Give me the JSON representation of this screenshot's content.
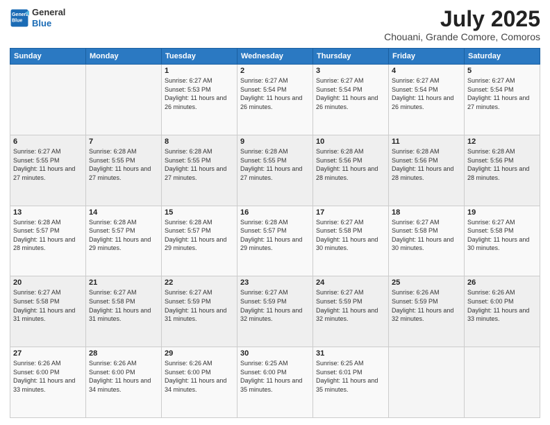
{
  "header": {
    "logo_line1": "General",
    "logo_line2": "Blue",
    "title": "July 2025",
    "subtitle": "Chouani, Grande Comore, Comoros"
  },
  "weekdays": [
    "Sunday",
    "Monday",
    "Tuesday",
    "Wednesday",
    "Thursday",
    "Friday",
    "Saturday"
  ],
  "weeks": [
    [
      {
        "day": "",
        "info": ""
      },
      {
        "day": "",
        "info": ""
      },
      {
        "day": "1",
        "info": "Sunrise: 6:27 AM\nSunset: 5:53 PM\nDaylight: 11 hours and 26 minutes."
      },
      {
        "day": "2",
        "info": "Sunrise: 6:27 AM\nSunset: 5:54 PM\nDaylight: 11 hours and 26 minutes."
      },
      {
        "day": "3",
        "info": "Sunrise: 6:27 AM\nSunset: 5:54 PM\nDaylight: 11 hours and 26 minutes."
      },
      {
        "day": "4",
        "info": "Sunrise: 6:27 AM\nSunset: 5:54 PM\nDaylight: 11 hours and 26 minutes."
      },
      {
        "day": "5",
        "info": "Sunrise: 6:27 AM\nSunset: 5:54 PM\nDaylight: 11 hours and 27 minutes."
      }
    ],
    [
      {
        "day": "6",
        "info": "Sunrise: 6:27 AM\nSunset: 5:55 PM\nDaylight: 11 hours and 27 minutes."
      },
      {
        "day": "7",
        "info": "Sunrise: 6:28 AM\nSunset: 5:55 PM\nDaylight: 11 hours and 27 minutes."
      },
      {
        "day": "8",
        "info": "Sunrise: 6:28 AM\nSunset: 5:55 PM\nDaylight: 11 hours and 27 minutes."
      },
      {
        "day": "9",
        "info": "Sunrise: 6:28 AM\nSunset: 5:55 PM\nDaylight: 11 hours and 27 minutes."
      },
      {
        "day": "10",
        "info": "Sunrise: 6:28 AM\nSunset: 5:56 PM\nDaylight: 11 hours and 28 minutes."
      },
      {
        "day": "11",
        "info": "Sunrise: 6:28 AM\nSunset: 5:56 PM\nDaylight: 11 hours and 28 minutes."
      },
      {
        "day": "12",
        "info": "Sunrise: 6:28 AM\nSunset: 5:56 PM\nDaylight: 11 hours and 28 minutes."
      }
    ],
    [
      {
        "day": "13",
        "info": "Sunrise: 6:28 AM\nSunset: 5:57 PM\nDaylight: 11 hours and 28 minutes."
      },
      {
        "day": "14",
        "info": "Sunrise: 6:28 AM\nSunset: 5:57 PM\nDaylight: 11 hours and 29 minutes."
      },
      {
        "day": "15",
        "info": "Sunrise: 6:28 AM\nSunset: 5:57 PM\nDaylight: 11 hours and 29 minutes."
      },
      {
        "day": "16",
        "info": "Sunrise: 6:28 AM\nSunset: 5:57 PM\nDaylight: 11 hours and 29 minutes."
      },
      {
        "day": "17",
        "info": "Sunrise: 6:27 AM\nSunset: 5:58 PM\nDaylight: 11 hours and 30 minutes."
      },
      {
        "day": "18",
        "info": "Sunrise: 6:27 AM\nSunset: 5:58 PM\nDaylight: 11 hours and 30 minutes."
      },
      {
        "day": "19",
        "info": "Sunrise: 6:27 AM\nSunset: 5:58 PM\nDaylight: 11 hours and 30 minutes."
      }
    ],
    [
      {
        "day": "20",
        "info": "Sunrise: 6:27 AM\nSunset: 5:58 PM\nDaylight: 11 hours and 31 minutes."
      },
      {
        "day": "21",
        "info": "Sunrise: 6:27 AM\nSunset: 5:58 PM\nDaylight: 11 hours and 31 minutes."
      },
      {
        "day": "22",
        "info": "Sunrise: 6:27 AM\nSunset: 5:59 PM\nDaylight: 11 hours and 31 minutes."
      },
      {
        "day": "23",
        "info": "Sunrise: 6:27 AM\nSunset: 5:59 PM\nDaylight: 11 hours and 32 minutes."
      },
      {
        "day": "24",
        "info": "Sunrise: 6:27 AM\nSunset: 5:59 PM\nDaylight: 11 hours and 32 minutes."
      },
      {
        "day": "25",
        "info": "Sunrise: 6:26 AM\nSunset: 5:59 PM\nDaylight: 11 hours and 32 minutes."
      },
      {
        "day": "26",
        "info": "Sunrise: 6:26 AM\nSunset: 6:00 PM\nDaylight: 11 hours and 33 minutes."
      }
    ],
    [
      {
        "day": "27",
        "info": "Sunrise: 6:26 AM\nSunset: 6:00 PM\nDaylight: 11 hours and 33 minutes."
      },
      {
        "day": "28",
        "info": "Sunrise: 6:26 AM\nSunset: 6:00 PM\nDaylight: 11 hours and 34 minutes."
      },
      {
        "day": "29",
        "info": "Sunrise: 6:26 AM\nSunset: 6:00 PM\nDaylight: 11 hours and 34 minutes."
      },
      {
        "day": "30",
        "info": "Sunrise: 6:25 AM\nSunset: 6:00 PM\nDaylight: 11 hours and 35 minutes."
      },
      {
        "day": "31",
        "info": "Sunrise: 6:25 AM\nSunset: 6:01 PM\nDaylight: 11 hours and 35 minutes."
      },
      {
        "day": "",
        "info": ""
      },
      {
        "day": "",
        "info": ""
      }
    ]
  ]
}
